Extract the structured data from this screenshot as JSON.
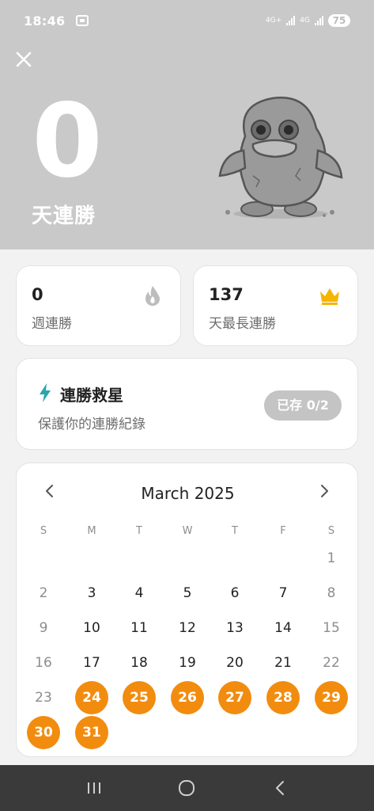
{
  "status_bar": {
    "time": "18:46",
    "network_1": "4G+",
    "network_2": "4G",
    "battery": "75"
  },
  "hero": {
    "streak_count": "0",
    "streak_label": "天連勝",
    "background_color": "#c9c9c9",
    "mascot": "gray-duck-mascot"
  },
  "stats": [
    {
      "value": "0",
      "label": "週連勝",
      "icon": "flame-icon"
    },
    {
      "value": "137",
      "label": "天最長連勝",
      "icon": "crown-icon"
    }
  ],
  "rescue": {
    "title": "連勝救星",
    "subtitle": "保護你的連勝紀錄",
    "badge": "已存 0/2",
    "icon": "lightning-bolt-icon"
  },
  "calendar": {
    "month_label": "March 2025",
    "weekdays": [
      "S",
      "M",
      "T",
      "W",
      "T",
      "F",
      "S"
    ],
    "first_weekday_index": 6,
    "days_in_month": 31,
    "highlighted_days": [
      24,
      25,
      26,
      27,
      28,
      29,
      30,
      31
    ],
    "accent_color": "#f28c0f"
  },
  "nav": {
    "recents": "recents-icon",
    "home": "home-icon",
    "back": "back-icon"
  }
}
